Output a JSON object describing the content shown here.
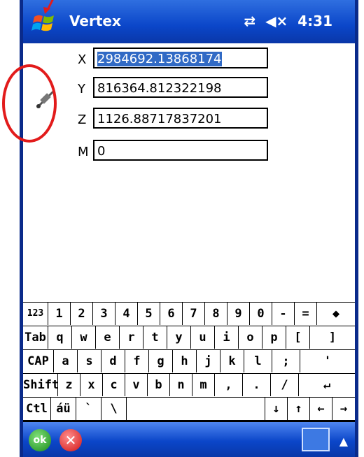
{
  "title_bar": {
    "app_title": "Vertex",
    "connectivity_icon": "sync-arrows-icon",
    "volume_icon": "speaker-muted-icon",
    "time": "4:31"
  },
  "fields": [
    {
      "label": "X",
      "value": "2984692.13868174",
      "selected": true
    },
    {
      "label": "Y",
      "value": "816364.812322198",
      "selected": false
    },
    {
      "label": "Z",
      "value": "1126.88717837201",
      "selected": false
    },
    {
      "label": "M",
      "value": "0",
      "selected": false
    }
  ],
  "gps_icon": "satellite-icon",
  "keyboard": {
    "row1": [
      "123",
      "1",
      "2",
      "3",
      "4",
      "5",
      "6",
      "7",
      "8",
      "9",
      "0",
      "-",
      "=",
      "◆"
    ],
    "row2": [
      "Tab",
      "q",
      "w",
      "e",
      "r",
      "t",
      "y",
      "u",
      "i",
      "o",
      "p",
      "[",
      "]"
    ],
    "row3": [
      "CAP",
      "a",
      "s",
      "d",
      "f",
      "g",
      "h",
      "j",
      "k",
      "l",
      ";",
      "'"
    ],
    "row4": [
      "Shift",
      "z",
      "x",
      "c",
      "v",
      "b",
      "n",
      "m",
      ",",
      ".",
      "/",
      "↵"
    ],
    "row5": [
      "Ctl",
      "áü",
      "`",
      "\\",
      "",
      "↓",
      "↑",
      "←",
      "→"
    ]
  },
  "bottom_bar": {
    "ok_label": "ok",
    "cancel_label": "✕"
  },
  "colors": {
    "titlebar": "#0b46c9",
    "selection": "#316ac5",
    "annotation": "#e21b1b"
  }
}
